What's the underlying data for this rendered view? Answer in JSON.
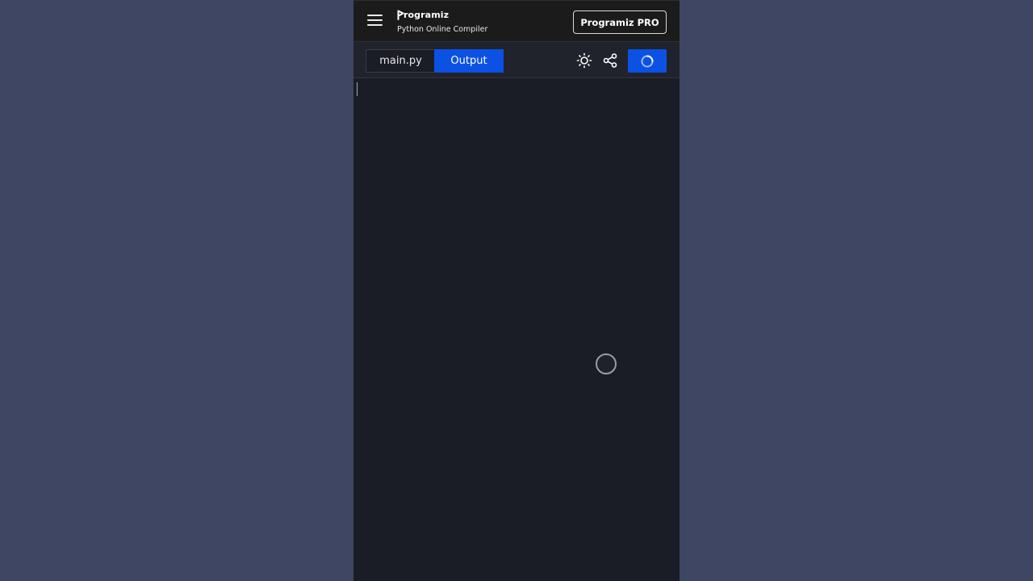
{
  "app": {
    "logo_text": "rogramiz",
    "subtitle": "Python Online Compiler",
    "pro_button_label": "Programiz PRO"
  },
  "toolbar": {
    "tabs": [
      {
        "label": "main.py",
        "active": false
      },
      {
        "label": "Output",
        "active": true
      }
    ],
    "theme_icon": "sun-icon",
    "share_icon": "share-icon",
    "run_state": "loading-spinner"
  },
  "output": {
    "text": ""
  },
  "colors": {
    "background": "#3e4663",
    "header": "#1b1b1c",
    "toolbar": "#20232b",
    "accent_blue": "#0b51e4",
    "editor_bg": "#1b1d26"
  }
}
